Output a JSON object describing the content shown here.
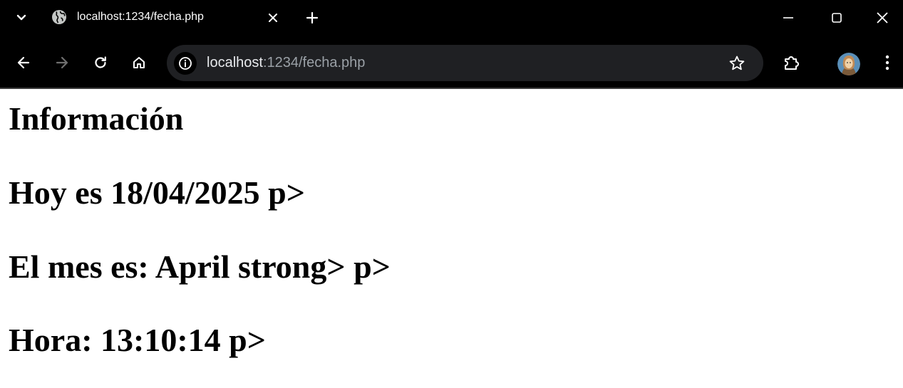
{
  "browser": {
    "tab": {
      "title": "localhost:1234/fecha.php",
      "favicon": "globe-icon"
    },
    "address_bar": {
      "host": "localhost",
      "rest": ":1234/fecha.php"
    },
    "colors": {
      "chrome_bg": "#000000",
      "omnibox_bg": "#1f2023",
      "url_host": "#e8eaed",
      "url_rest": "#9aa0a6"
    }
  },
  "page": {
    "heading": "Información",
    "lines": [
      "Hoy es 18/04/2025 p>",
      "El mes es: April strong> p>",
      "Hora: 13:10:14 p>"
    ]
  }
}
